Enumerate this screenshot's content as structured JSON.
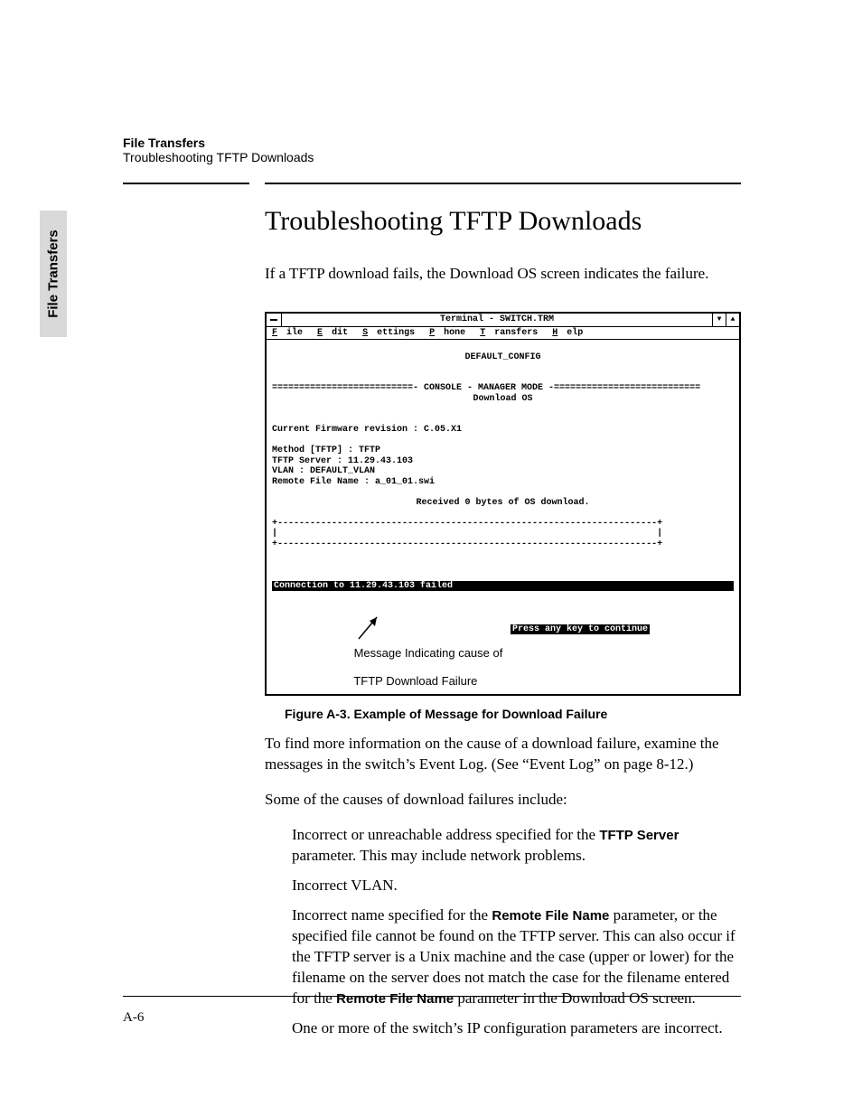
{
  "side_tab": "File Transfers",
  "running_head": {
    "line1": "File Transfers",
    "line2": "Troubleshooting TFTP Downloads"
  },
  "title": "Troubleshooting TFTP Downloads",
  "lead": "If a TFTP download fails, the Download OS screen indicates the failure.",
  "figure": {
    "window_title": "Terminal - SWITCH.TRM",
    "menus": [
      "File",
      "Edit",
      "Settings",
      "Phone",
      "Transfers",
      "Help"
    ],
    "header_right": "DEFAULT_CONFIG",
    "mode_line": "==========================- CONSOLE - MANAGER MODE -===========================",
    "subtitle": "Download OS",
    "firmware": "Current Firmware revision : C.05.X1",
    "lines": [
      "Method [TFTP] : TFTP",
      "TFTP Server : 11.29.43.103",
      "VLAN : DEFAULT_VLAN",
      "Remote File Name : a_01_01.swi"
    ],
    "received": "Received 0 bytes of OS download.",
    "bar_top": "+----------------------------------------------------------------------+",
    "bar_mid": "|                                                                      |",
    "bar_bot": "+----------------------------------------------------------------------+",
    "fail_msg": "Connection to 11.29.43.103 failed",
    "press_key": "Press any key to continue",
    "callout_l1": "Message Indicating cause of",
    "callout_l2": "TFTP Download Failure",
    "caption": "Figure A-3.   Example of Message for Download Failure"
  },
  "para_after": "To find more information on the cause of a download failure, examine the messages in the switch’s Event Log. (See “Event Log” on page 8-12.)",
  "list_intro": "Some of the causes of download failures include:",
  "bullets": {
    "b1_pre": "Incorrect or unreachable address specified for the ",
    "b1_bold": "TFTP Server",
    "b1_post": " parameter. This may include network problems.",
    "b2": "Incorrect VLAN.",
    "b3_pre": "Incorrect name specified for the ",
    "b3_bold1": "Remote File Name",
    "b3_mid": " parameter, or the specified file cannot be found on the TFTP server. This can also occur if the TFTP server is a Unix machine and the case (upper or lower) for the filename on the server does not match the case for the filename entered for the  ",
    "b3_bold2": "Remote File Name",
    "b3_post": "  parameter in the Download OS screen.",
    "b4": "One or more of the switch’s IP configuration parameters are incorrect."
  },
  "page_number": "A-6"
}
